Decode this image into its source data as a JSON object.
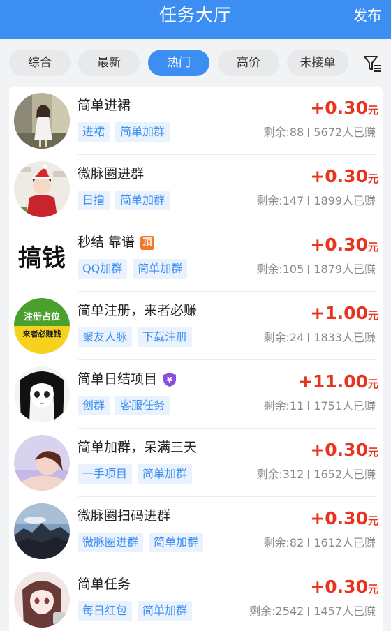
{
  "header": {
    "title": "任务大厅",
    "publish": "发布"
  },
  "tabs": [
    "综合",
    "最新",
    "热门",
    "高价",
    "未接单"
  ],
  "active_tab": "热门",
  "tasks": [
    {
      "name": "简单进裙",
      "price": "+0.30",
      "unit": "元",
      "tags": [
        "进裙",
        "简单加群"
      ],
      "remaining": "剩余:88",
      "earned": "5672人已赚"
    },
    {
      "name": "微脉圈进群",
      "price": "+0.30",
      "unit": "元",
      "tags": [
        "日撸",
        "简单加群"
      ],
      "remaining": "剩余:147",
      "earned": "1899人已赚"
    },
    {
      "name": "秒结 靠谱",
      "badge": "顶",
      "price": "+0.30",
      "unit": "元",
      "tags": [
        "QQ加群",
        "简单加群"
      ],
      "remaining": "剩余:105",
      "earned": "1879人已赚",
      "avatar_text": "搞钱"
    },
    {
      "name": "简单注册，来者必赚",
      "price": "+1.00",
      "unit": "元",
      "tags": [
        "聚友人脉",
        "下载注册"
      ],
      "remaining": "剩余:24",
      "earned": "1833人已赚",
      "avatar_text": [
        "注册占位",
        "来者必赚钱"
      ]
    },
    {
      "name": "简单日结项目",
      "badge": "¥",
      "price": "+11.00",
      "unit": "元",
      "tags": [
        "创群",
        "客服任务"
      ],
      "remaining": "剩余:11",
      "earned": "1751人已赚"
    },
    {
      "name": "简单加群，呆满三天",
      "price": "+0.30",
      "unit": "元",
      "tags": [
        "一手项目",
        "简单加群"
      ],
      "remaining": "剩余:312",
      "earned": "1652人已赚"
    },
    {
      "name": "微脉圈扫码进群",
      "price": "+0.30",
      "unit": "元",
      "tags": [
        "微脉圈进群",
        "简单加群"
      ],
      "remaining": "剩余:82",
      "earned": "1612人已赚"
    },
    {
      "name": "简单任务",
      "price": "+0.30",
      "unit": "元",
      "tags": [
        "每日红包",
        "简单加群"
      ],
      "remaining": "剩余:2542",
      "earned": "1457人已赚"
    }
  ],
  "colors": {
    "primary": "#3d8ef2",
    "price": "#e8341f",
    "tag_bg": "#e9f2fd"
  },
  "icons": {
    "filter": "filter-sort-icon"
  }
}
